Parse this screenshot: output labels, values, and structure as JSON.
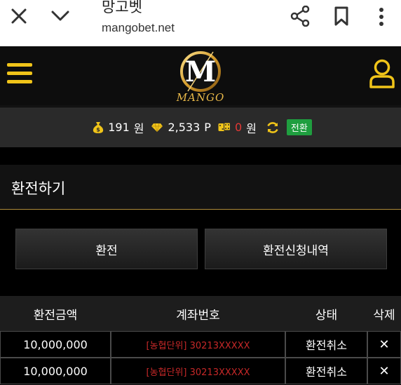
{
  "browser": {
    "title": "망고벳",
    "url": "mangobet.net",
    "icons": [
      "close-icon",
      "chevron-down-icon",
      "share-icon",
      "bookmark-icon",
      "more-vert-icon"
    ]
  },
  "header": {
    "logo_text": "MANGO",
    "logo_letter": "M",
    "accent_color": "#f0c419"
  },
  "balance": {
    "money_value": "191",
    "money_unit": "원",
    "point_value": "2,533",
    "point_unit": "P",
    "casino_value": "0",
    "casino_unit": "원",
    "convert_label": "전환"
  },
  "section": {
    "title": "환전하기"
  },
  "buttons": {
    "exchange_label": "환전",
    "history_label": "환전신청내역"
  },
  "table": {
    "headers": [
      "환전금액",
      "계좌번호",
      "상태",
      "삭제"
    ],
    "rows": [
      {
        "amount": "10,000,000",
        "account": "[농협단위] 30213XXXXX",
        "status": "환전취소",
        "delete": "✕"
      },
      {
        "amount": "10,000,000",
        "account": "[농협단위] 30213XXXXX",
        "status": "환전취소",
        "delete": "✕"
      }
    ]
  }
}
